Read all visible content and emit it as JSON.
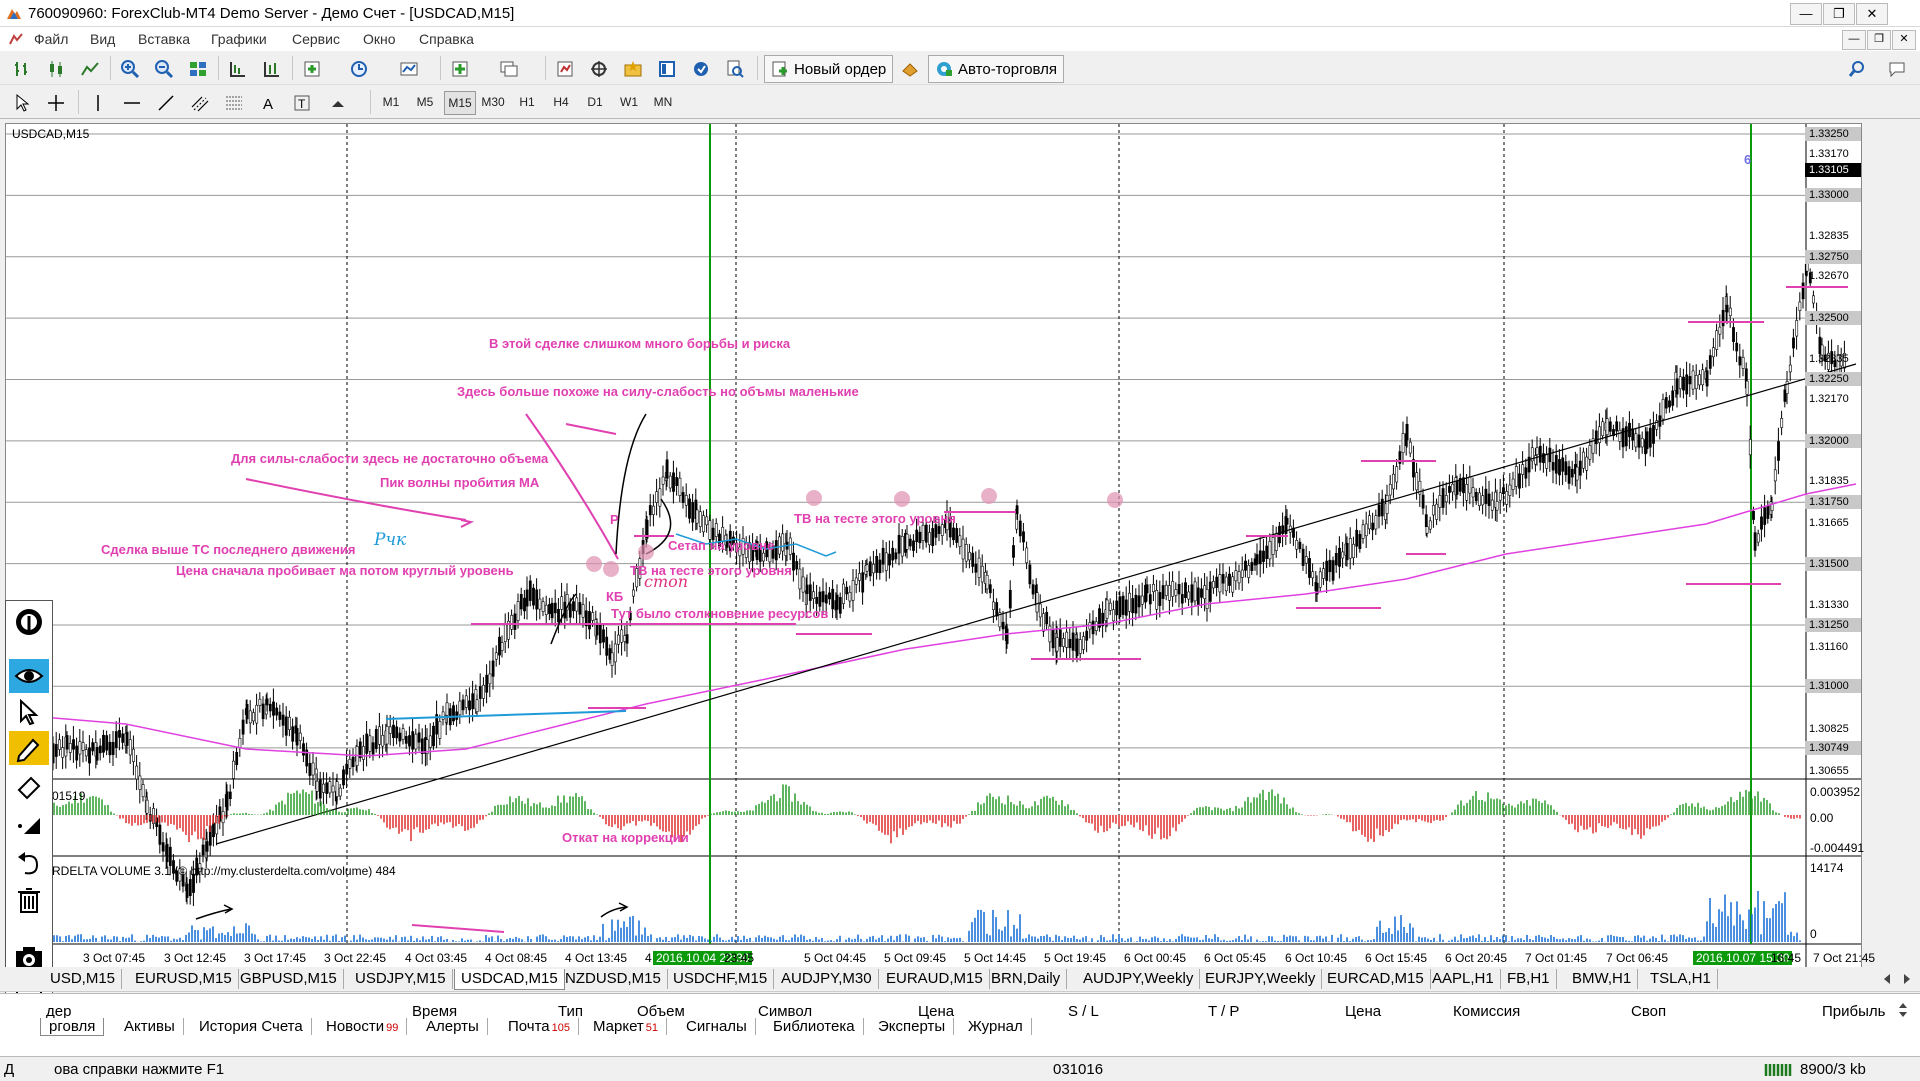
{
  "window": {
    "title": "760090960: ForexClub-MT4 Demo Server - Демо Счет - [USDCAD,M15]"
  },
  "menu": [
    "Файл",
    "Вид",
    "Вставка",
    "Графики",
    "Сервис",
    "Окно",
    "Справка"
  ],
  "toolbar": {
    "new_order": "Новый ордер",
    "auto_trading": "Авто-торговля"
  },
  "timeframes": [
    "M1",
    "M5",
    "M15",
    "M30",
    "H1",
    "H4",
    "D1",
    "W1",
    "MN"
  ],
  "active_timeframe": "M15",
  "chart": {
    "label": "USDCAD,M15",
    "price_labels": [
      "1.33250",
      "1.33170",
      "1.33105",
      "1.33000",
      "1.32835",
      "1.32750",
      "1.32670",
      "1.32500",
      "1.32335",
      "1.32250",
      "1.32170",
      "1.32000",
      "1.31835",
      "1.31750",
      "1.31665",
      "1.31500",
      "1.31330",
      "1.31250",
      "1.31160",
      "1.31000",
      "1.30825",
      "1.30749",
      "1.30655"
    ],
    "current_price": "1.33105",
    "osc_labels": {
      "name": "01519",
      "top": "0.003952",
      "mid": "0.00",
      "bottom": "-0.004491"
    },
    "volume_labels": {
      "name": "RDELTA VOLUME 3.1 (© http://my.clusterdelta.com/volume) 484",
      "top": "14174",
      "bottom": "0"
    },
    "time_labels": [
      "3 Oct 07:45",
      "3 Oct 12:45",
      "3 Oct 17:45",
      "3 Oct 22:45",
      "4 Oct 03:45",
      "4 Oct 08:45",
      "4 Oct 13:45",
      "2016.10.04 22:30",
      "23:45",
      "5 Oct 04:45",
      "5 Oct 09:45",
      "5 Oct 14:45",
      "5 Oct 19:45",
      "6 Oct 00:45",
      "6 Oct 05:45",
      "6 Oct 10:45",
      "6 Oct 15:45",
      "6 Oct 20:45",
      "7 Oct 01:45",
      "7 Oct 06:45",
      "2016.10.07 15:30",
      "16:45",
      "7 Oct 21:45"
    ],
    "time_label_first": "16",
    "time_label_partial": "4",
    "annotations": [
      "В этой сделке слишком много борьбы и риска",
      "Здесь больше похоже на силу-слабость но объмы маленькие",
      "Для силы-слабости здесь не достаточно объема",
      "Пик волны пробития МА",
      "ТВ на тесте этого уровня",
      "Сетап на уровне",
      "Сделка  выше ТС последнего движения",
      "Цена сначала пробивает ма потом круглый уровень",
      "ТВ на тесте этого уровня",
      "КБ",
      "Тут было столкновение ресурсов",
      "Откат на коррекции",
      "6",
      "Р"
    ],
    "handwritten": [
      "Рчк",
      "стоп"
    ]
  },
  "symbol_tabs": [
    "USD,M15",
    "EURUSD,M15",
    "GBPUSD,M15",
    "USDJPY,M15",
    "USDCAD,M15",
    "NZDUSD,M15",
    "USDCHF,M15",
    "AUDJPY,M30",
    "EURAUD,M15",
    "BRN,Daily",
    "AUDJPY,Weekly",
    "EURJPY,Weekly",
    "EURCAD,M15",
    "AAPL,H1",
    "FB,H1",
    "BMW,H1",
    "TSLA,H1"
  ],
  "active_symbol_tab": "USDCAD,M15",
  "terminal_headers": [
    "дер",
    "Время",
    "Тип",
    "Объем",
    "Символ",
    "Цена",
    "S / L",
    "T / P",
    "Цена",
    "Комиссия",
    "Своп",
    "Прибыль"
  ],
  "bottom_tabs": [
    {
      "label": "рговля",
      "badge": ""
    },
    {
      "label": "Активы",
      "badge": ""
    },
    {
      "label": "История Счета",
      "badge": ""
    },
    {
      "label": "Новости",
      "badge": "99"
    },
    {
      "label": "Алерты",
      "badge": ""
    },
    {
      "label": "Почта",
      "badge": "105"
    },
    {
      "label": "Маркет",
      "badge": "51"
    },
    {
      "label": "Сигналы",
      "badge": ""
    },
    {
      "label": "Библиотека",
      "badge": ""
    },
    {
      "label": "Эксперты",
      "badge": ""
    },
    {
      "label": "Журнал",
      "badge": ""
    }
  ],
  "status": {
    "help": "ова справки нажмите F1",
    "prefix": "Д",
    "profile": "031016",
    "traffic": "8900/3 kb"
  },
  "colors": {
    "annotation": "#e040b0",
    "ma": "#e040e0",
    "vline": "#0b9a0b",
    "volume": "#1e73d9",
    "osc_up": "#2a9d2a",
    "osc_down": "#e03030"
  }
}
